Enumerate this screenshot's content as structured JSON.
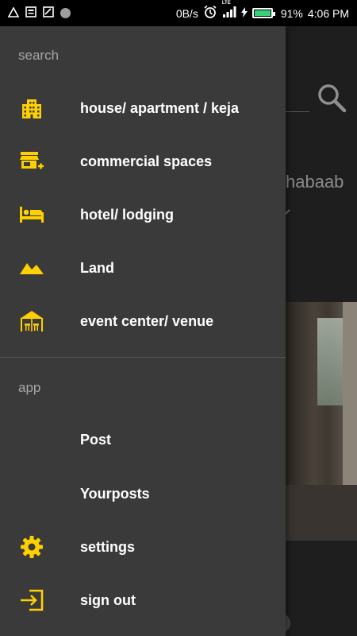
{
  "status_bar": {
    "speed": "0B/s",
    "network_label": "LTE",
    "battery_percent": "91%",
    "time": "4:06 PM",
    "battery_level": 0.91,
    "battery_color": "#36d17a"
  },
  "background": {
    "partial_text": "habaab",
    "search_icon": "search-icon"
  },
  "drawer": {
    "accent_color": "#ffd000",
    "sections": [
      {
        "title": "search",
        "items": [
          {
            "label": "house/ apartment / keja",
            "icon": "building-icon"
          },
          {
            "label": "commercial spaces",
            "icon": "store-add-icon"
          },
          {
            "label": "hotel/ lodging",
            "icon": "hotel-bed-icon"
          },
          {
            "label": "Land",
            "icon": "landscape-icon"
          },
          {
            "label": "event center/ venue",
            "icon": "venue-tent-icon"
          }
        ]
      },
      {
        "title": "app",
        "items": [
          {
            "label": "Post",
            "icon": ""
          },
          {
            "label": "Yourposts",
            "icon": ""
          },
          {
            "label": "settings",
            "icon": "gear-icon"
          },
          {
            "label": "sign out",
            "icon": "sign-out-icon"
          }
        ]
      }
    ]
  }
}
